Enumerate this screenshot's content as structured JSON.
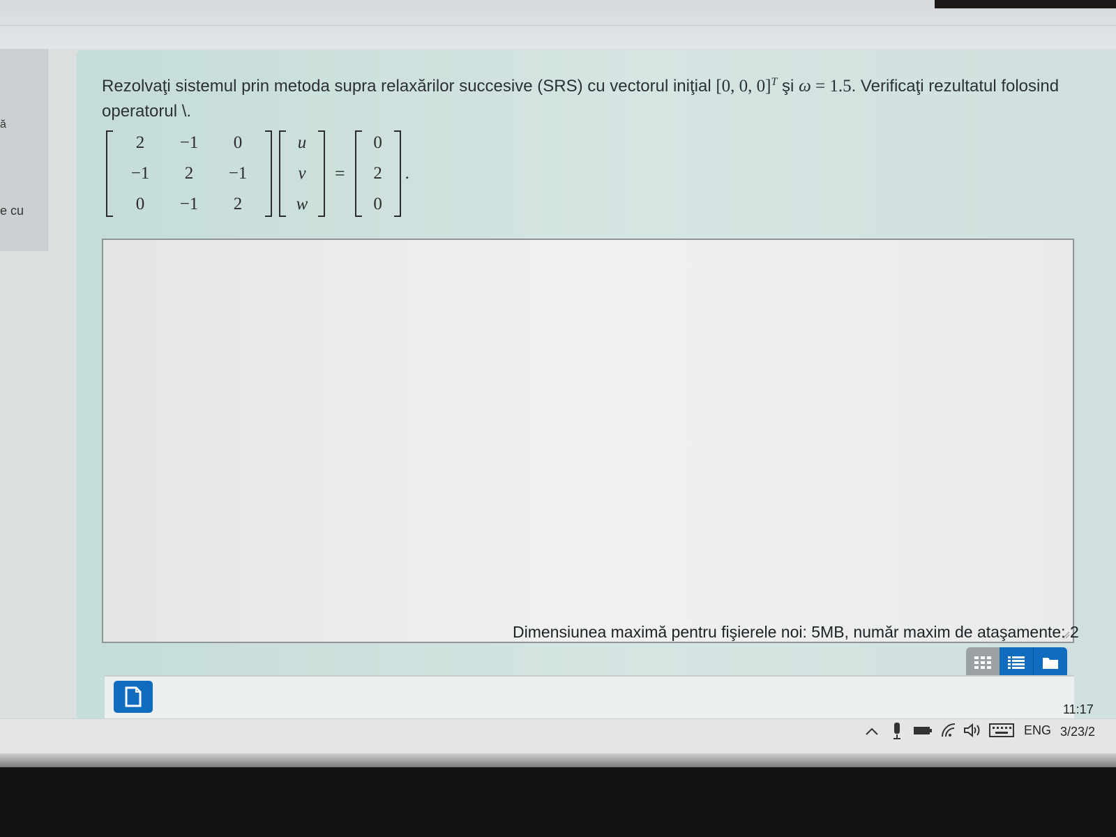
{
  "sidebar": {
    "fragment_1": "ă",
    "fragment_2": "e cu"
  },
  "question": {
    "text_part1": "Rezolvaţi sistemul prin metoda supra relaxărilor succesive (SRS) cu vectorul iniţial ",
    "initial_vector": "[0, 0, 0]",
    "transpose": "T",
    "text_part2": " şi ",
    "omega_symbol": "ω",
    "omega_value": " = 1.5",
    "text_part3": ". Verificaţi rezultatul folosind operatorul \\.",
    "matrix": [
      [
        "2",
        "−1",
        "0"
      ],
      [
        "−1",
        "2",
        "−1"
      ],
      [
        "0",
        "−1",
        "2"
      ]
    ],
    "unknowns": [
      "u",
      "v",
      "w"
    ],
    "rhs": [
      "0",
      "2",
      "0"
    ],
    "equals": "=",
    "end_dot": "."
  },
  "attachments": {
    "limits_text": "Dimensiunea maximă pentru fişierele noi: 5MB, număr maxim de ataşamente: 2",
    "view_buttons": [
      "grid-view-icon",
      "list-view-icon",
      "folder-view-icon"
    ],
    "add_icon": "add-file-icon"
  },
  "taskbar": {
    "language": "ENG",
    "time": "11:17",
    "date": "3/23/2"
  },
  "colors": {
    "accent": "#0f6cbf",
    "question_bg": "#cfe0de"
  }
}
